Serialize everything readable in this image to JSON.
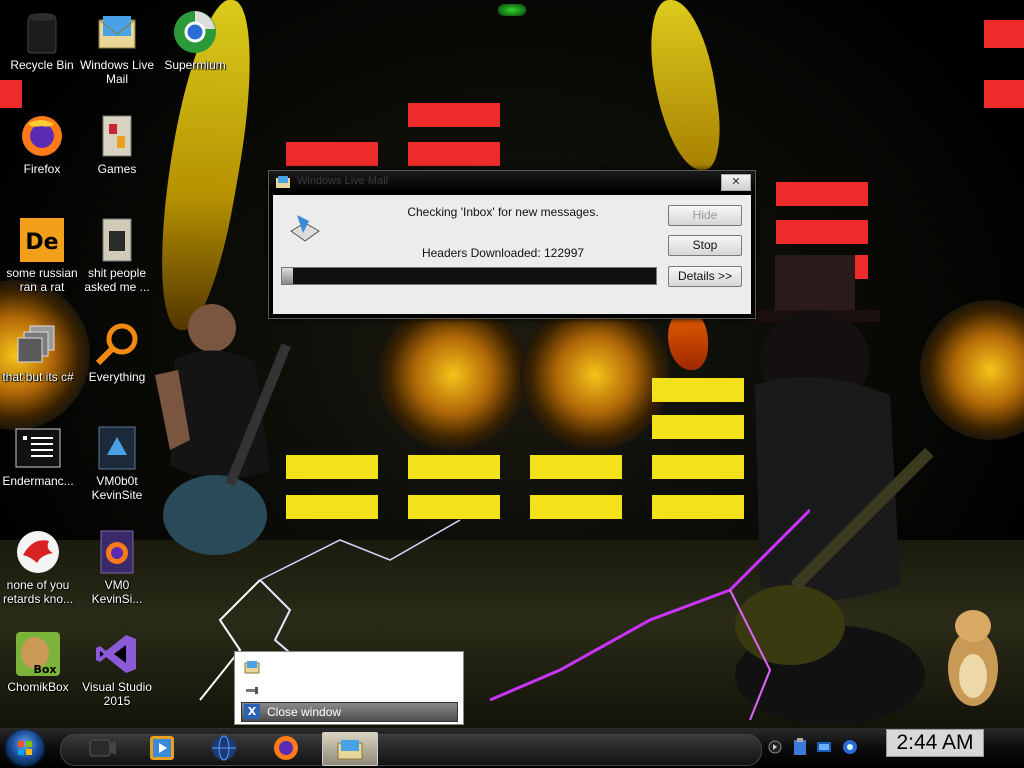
{
  "desktop": {
    "icons": [
      {
        "label": "Recycle Bin",
        "icon": "recycle-bin-icon"
      },
      {
        "label": "Windows Live\nMail",
        "icon": "windows-live-mail-icon"
      },
      {
        "label": "Supermium",
        "icon": "supermium-icon"
      },
      {
        "label": "Firefox",
        "icon": "firefox-icon"
      },
      {
        "label": "Games",
        "icon": "games-folder-icon"
      },
      {
        "label": "some russian\nran a rat",
        "icon": "de-app-icon"
      },
      {
        "label": "shit people\nasked me ...",
        "icon": "folder-icon"
      },
      {
        "label": "that but its c#",
        "icon": "stacked-windows-icon"
      },
      {
        "label": "Everything",
        "icon": "magnifier-icon"
      },
      {
        "label": "Endermanc...",
        "icon": "console-icon"
      },
      {
        "label": "VM0b0t\nKevinSite",
        "icon": "vm-shortcut-icon"
      },
      {
        "label": "none of you\nretards kno...",
        "icon": "dragon-app-icon"
      },
      {
        "label": "VM0\nKevinSi...",
        "icon": "firefox-file-icon"
      },
      {
        "label": "ChomikBox",
        "icon": "chomikbox-icon"
      },
      {
        "label": "Visual Studio\n2015",
        "icon": "visual-studio-icon"
      }
    ]
  },
  "dialog": {
    "title": "Windows Live Mail",
    "status_line": "Checking 'Inbox' for new messages.",
    "headers_line": "Headers Downloaded: 122997",
    "progress_percent": 3,
    "buttons": {
      "hide": "Hide",
      "stop": "Stop",
      "details": "Details >>"
    },
    "close_glyph": "✕"
  },
  "taskbar_popup": {
    "close_label": "Close window",
    "close_glyph": "X"
  },
  "taskbar": {
    "clock": "2:44 AM",
    "pinned": [
      "media-player-icon",
      "windows-media-player-icon",
      "network-globe-icon",
      "firefox-icon",
      "windows-live-mail-icon"
    ]
  },
  "colors": {
    "taskbar": "#0c0c0c",
    "dialog_client": "#ececec",
    "eq_red": "#ee2b2b",
    "eq_yellow": "#f3e11a"
  }
}
